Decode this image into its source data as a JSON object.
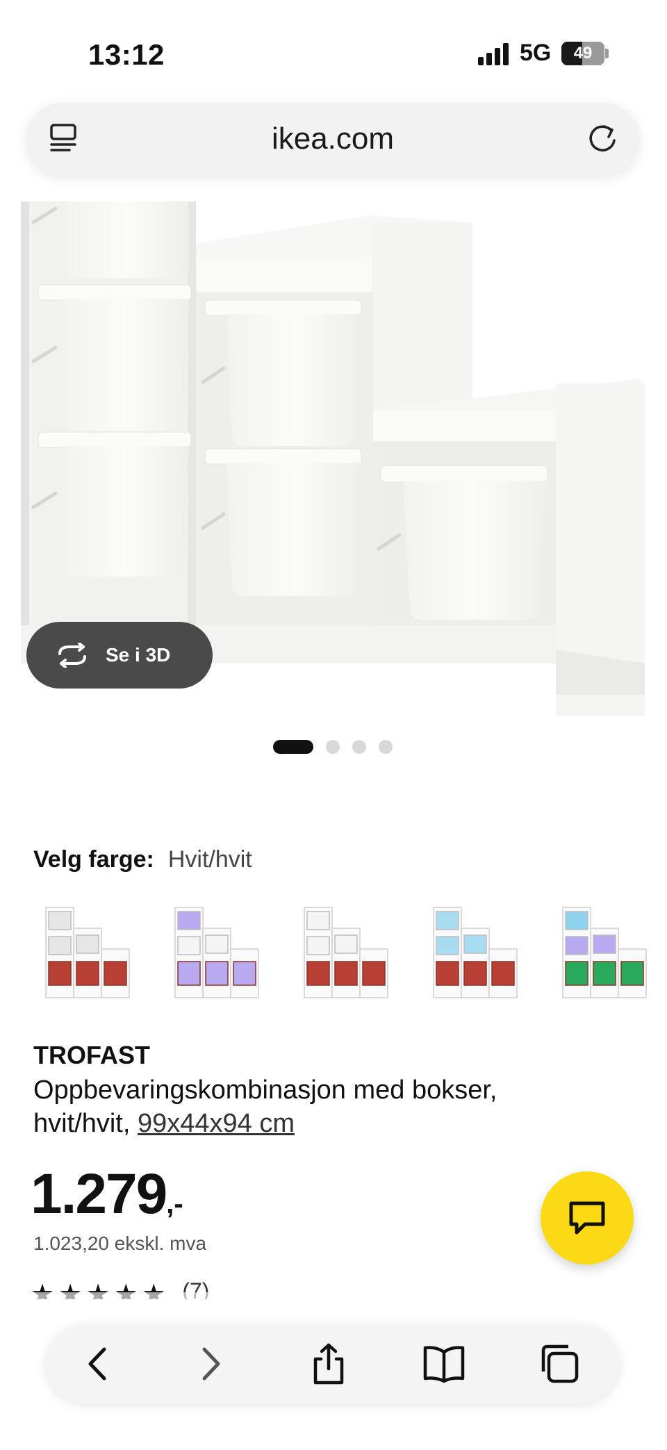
{
  "status_bar": {
    "time": "13:12",
    "network": "5G",
    "battery": "49",
    "battery_level": 0.49
  },
  "browser": {
    "domain": "ikea.com",
    "tabs_icon": "tab-overview-icon",
    "reload_icon": "reload-icon"
  },
  "gallery": {
    "view_3d_label": "Se i 3D",
    "view_3d_icon": "rotate-3d-icon",
    "image_count": 4,
    "active_image": 1
  },
  "color_picker": {
    "label": "Velg farge:",
    "selected": "Hvit/hvit",
    "options": [
      {
        "name": "white-red",
        "boxes": [
          "#e6e6e6",
          "#e6e6e6",
          "#b94034"
        ]
      },
      {
        "name": "white-purple",
        "boxes": [
          "#b9a9f0",
          "#f4f4f4",
          "#b9a9f0"
        ]
      },
      {
        "name": "white-red-2",
        "boxes": [
          "#f4f4f4",
          "#f4f4f4",
          "#b94034"
        ]
      },
      {
        "name": "blue-red",
        "boxes": [
          "#a8dcf0",
          "#a8dcf0",
          "#b94034"
        ]
      },
      {
        "name": "blue-purple-green",
        "boxes": [
          "#8fd2ee",
          "#b9a9f0",
          "#2aaa5c"
        ]
      }
    ]
  },
  "product": {
    "brand": "TROFAST",
    "description_prefix": "Oppbevaringskombinasjon med bokser, hvit/hvit, ",
    "dimensions": "99x44x94 cm",
    "price_main": "1.279",
    "price_suffix": ",-",
    "price_ex_vat": "1.023,20 ekskl. mva",
    "rating_stars": "★★★★★",
    "rating_count": "(7)"
  },
  "chat_button": {
    "icon": "chat-icon"
  },
  "toolbar": {
    "back_icon": "back-icon",
    "forward_icon": "forward-icon",
    "share_icon": "share-icon",
    "bookmarks_icon": "bookmarks-icon",
    "tabs_icon": "tabs-icon"
  }
}
